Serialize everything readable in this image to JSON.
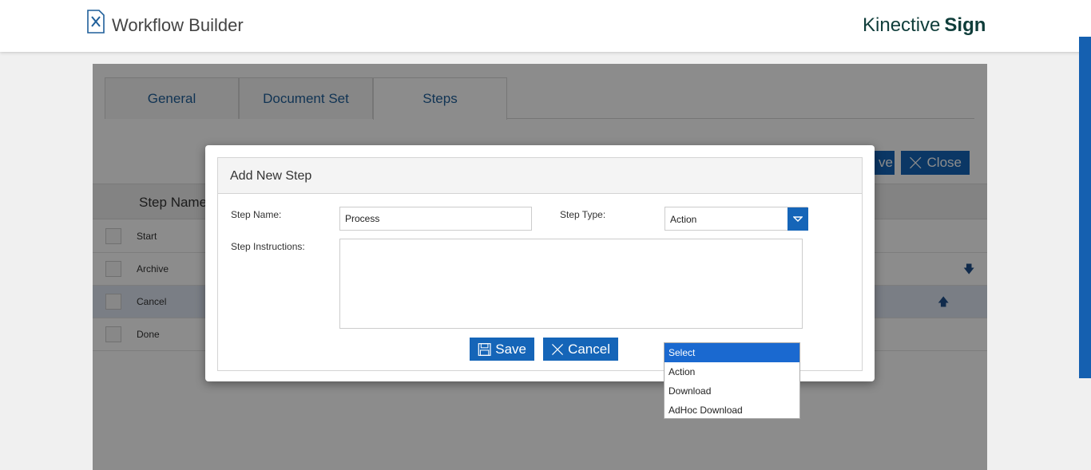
{
  "header": {
    "app_title": "Workflow Builder",
    "app_icon": "tools-icon",
    "brand_light": "Kinective",
    "brand_bold": "Sign"
  },
  "tabs": [
    {
      "label": "General"
    },
    {
      "label": "Document Set"
    },
    {
      "label": "Steps",
      "active": true
    }
  ],
  "toolbar": {
    "save_label_partial": "ve",
    "close_label": "Close"
  },
  "grid": {
    "column_header": "Step Name",
    "rows": [
      {
        "label": "Start"
      },
      {
        "label": "Archive",
        "arrow": "down"
      },
      {
        "label": "Cancel",
        "arrow": "up",
        "selected": true
      },
      {
        "label": "Done"
      }
    ]
  },
  "modal": {
    "title": "Add New Step",
    "step_name_label": "Step Name:",
    "step_name_value": "Process",
    "step_type_label": "Step Type:",
    "step_type_value": "Action",
    "instructions_label": "Step Instructions:",
    "instructions_value": "",
    "save_label": "Save",
    "cancel_label": "Cancel"
  },
  "dropdown": {
    "options": [
      "Select",
      "Action",
      "Download",
      "AdHoc Download"
    ],
    "highlighted": "Select"
  },
  "colors": {
    "accent": "#1565b8",
    "brand": "#0f3d3a",
    "highlight": "#1a69d0"
  }
}
